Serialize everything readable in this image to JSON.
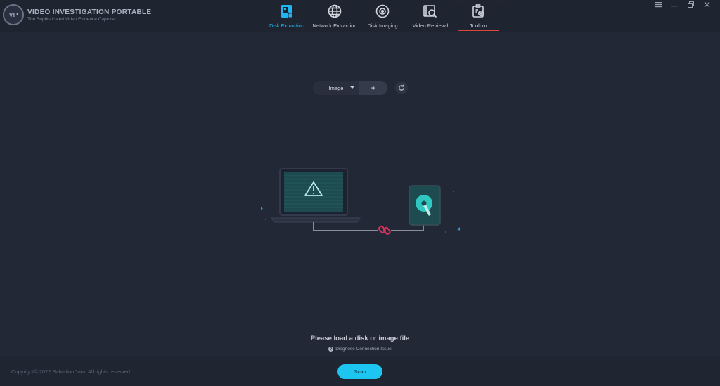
{
  "app": {
    "logo_badge": "VIP",
    "title": "VIDEO INVESTIGATION PORTABLE",
    "subtitle": "The Sophisticated Video Evidence Capturer"
  },
  "nav": {
    "items": [
      {
        "label": "Disk Extraction",
        "icon": "disk-extraction-icon",
        "active": true
      },
      {
        "label": "Network Extraction",
        "icon": "network-globe-icon",
        "active": false
      },
      {
        "label": "Disk Imaging",
        "icon": "disk-imaging-icon",
        "active": false
      },
      {
        "label": "Video Retrieval",
        "icon": "video-search-icon",
        "active": false
      },
      {
        "label": "Toolbox",
        "icon": "toolbox-icon",
        "active": false,
        "highlighted": true
      }
    ],
    "active_color": "#1fb6f2",
    "highlight_color": "#e0473c"
  },
  "window_controls": [
    "menu-icon",
    "minimize-icon",
    "restore-icon",
    "close-icon"
  ],
  "source": {
    "selected": "Image",
    "add_symbol": "+"
  },
  "messages": {
    "load": "Please load a disk or image file",
    "diagnose": "Diagnose Connection Issue"
  },
  "footer": {
    "copyright": "Copyright© 2022 SalvationData. All rights reserved.",
    "scan_label": "Scan",
    "scan_color": "#1cc6f0"
  }
}
